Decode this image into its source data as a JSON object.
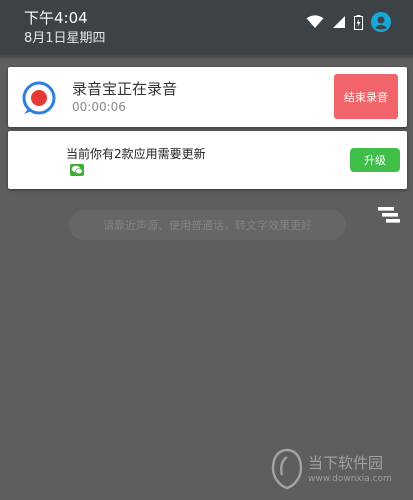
{
  "status_bar": {
    "time": "下午4:04",
    "date": "8月1日星期四",
    "icons": [
      "wifi-icon",
      "signal-icon",
      "battery-charging-icon",
      "account-icon"
    ]
  },
  "recording_notification": {
    "icon": "recorder-icon",
    "icon_color": "#e53935",
    "title": "录音宝正在录音",
    "elapsed": "00:00:06",
    "stop_label": "结束录音",
    "stop_color": "#f0646a"
  },
  "update_notification": {
    "title": "当前你有2款应用需要更新",
    "app_icons": [
      "wechat-icon"
    ],
    "upgrade_label": "升级",
    "upgrade_color": "#3fbf4a"
  },
  "hint_text": "请靠近声源、使用普通话，转文字效果更好",
  "clear_all_icon": "clear-all-icon",
  "watermark": {
    "name": "当下软件园",
    "url": "www.downxia.com"
  }
}
